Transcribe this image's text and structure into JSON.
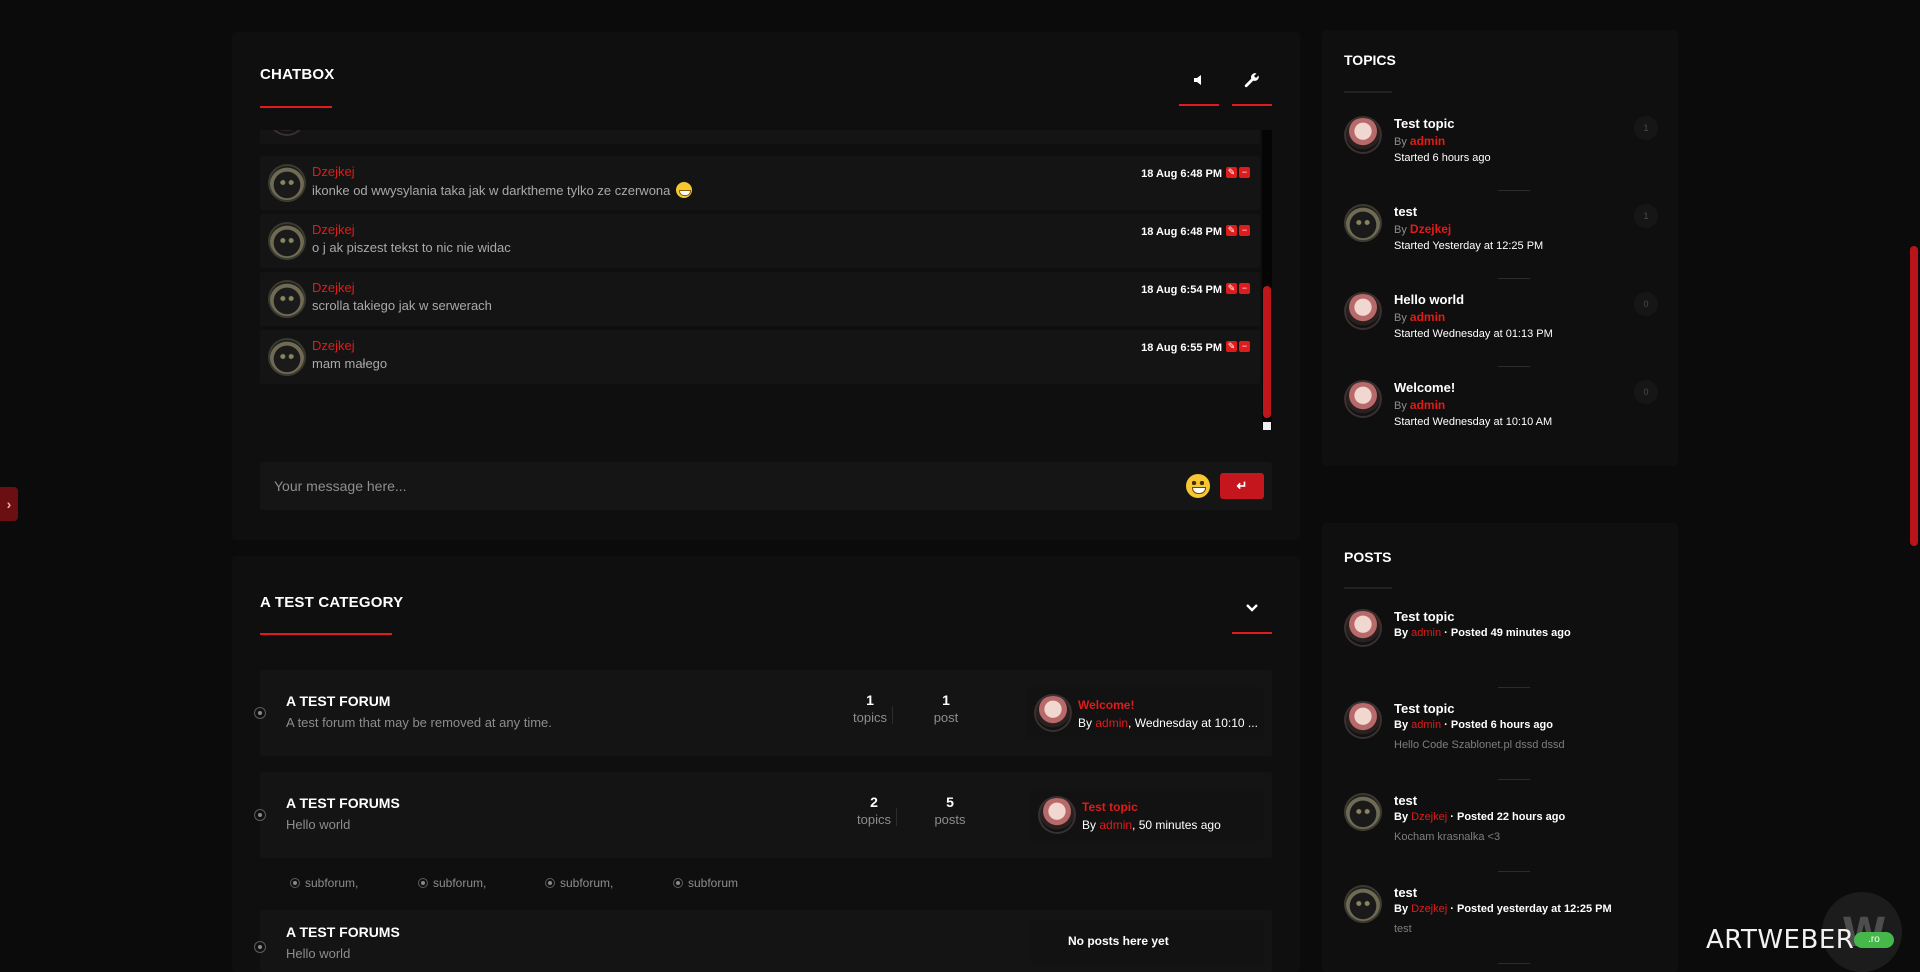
{
  "drawer": {
    "label": "›"
  },
  "chatbox": {
    "title": "CHATBOX",
    "messages": [
      {
        "author": "Dzejkej",
        "text": "ikonke od wwysylania taka jak w darktheme tylko ze czerwona",
        "time": "18 Aug 6:48 PM",
        "emoji": true
      },
      {
        "author": "Dzejkej",
        "text": "o j ak piszest tekst to nic nie widac",
        "time": "18 Aug 6:48 PM"
      },
      {
        "author": "Dzejkej",
        "text": "scrolla takiego jak w serwerach",
        "time": "18 Aug 6:54 PM"
      },
      {
        "author": "Dzejkej",
        "text": "mam małego",
        "time": "18 Aug 6:55 PM"
      }
    ],
    "input_placeholder": "Your message here...",
    "send_label": "↵"
  },
  "category": {
    "title": "A TEST CATEGORY",
    "forums": [
      {
        "name": "A TEST FORUM",
        "desc": "A test forum that may be removed at any time.",
        "topics": "1",
        "topics_label": "topics",
        "posts": "1",
        "posts_label": "post",
        "last_title": "Welcome!",
        "last_by_prefix": "By",
        "last_user": "admin",
        "last_when": ", Wednesday at 10:10 ..."
      },
      {
        "name": "A TEST FORUMS",
        "desc": "Hello world",
        "topics": "2",
        "topics_label": "topics",
        "posts": "5",
        "posts_label": "posts",
        "last_title": "Test topic",
        "last_by_prefix": "By",
        "last_user": "admin",
        "last_when": ", 50 minutes ago"
      },
      {
        "name": "A TEST FORUMS",
        "desc": "Hello world",
        "no_posts": "No posts here yet"
      }
    ],
    "subforums": [
      "subforum,",
      "subforum,",
      "subforum,",
      "subforum"
    ]
  },
  "topics": {
    "title": "TOPICS",
    "items": [
      {
        "title": "Test topic",
        "by": "By",
        "user": "admin",
        "started": "Started 6 hours ago",
        "count": "1",
        "avatar": "anime"
      },
      {
        "title": "test",
        "by": "By",
        "user": "Dzejkej",
        "started": "Started Yesterday at 12:25 PM",
        "count": "1",
        "avatar": "cat"
      },
      {
        "title": "Hello world",
        "by": "By",
        "user": "admin",
        "started": "Started Wednesday at 01:13 PM",
        "count": "0",
        "avatar": "anime"
      },
      {
        "title": "Welcome!",
        "by": "By",
        "user": "admin",
        "started": "Started Wednesday at 10:10 AM",
        "count": "0",
        "avatar": "anime"
      }
    ]
  },
  "posts": {
    "title": "POSTS",
    "items": [
      {
        "title": "Test topic",
        "by": "By",
        "user": "admin",
        "meta": "· Posted 49 minutes ago",
        "excerpt": "",
        "avatar": "anime"
      },
      {
        "title": "Test topic",
        "by": "By",
        "user": "admin",
        "meta": "· Posted 6 hours ago",
        "excerpt": "Hello Code Szablonet.pl   dssd dssd",
        "avatar": "anime"
      },
      {
        "title": "test",
        "by": "By",
        "user": "Dzejkej",
        "meta": "· Posted 22 hours ago",
        "excerpt": "Kocham krasnalka <3",
        "avatar": "cat"
      },
      {
        "title": "test",
        "by": "By",
        "user": "Dzejkej",
        "meta": "· Posted yesterday at 12:25 PM",
        "excerpt": "test",
        "avatar": "cat"
      }
    ]
  },
  "watermark": {
    "text": "ARTWEBER",
    "badge": ".ro",
    "logo_letter": "W"
  },
  "colors": {
    "accent": "#e01b1b",
    "background": "#0b0b0b",
    "panel": "#0f0f0f",
    "row": "#141414"
  },
  "icons": {
    "sound": "speaker-icon",
    "settings": "wrench-icon",
    "collapse": "chevron-down-icon",
    "edit": "pencil-icon",
    "delete": "minus-icon"
  }
}
